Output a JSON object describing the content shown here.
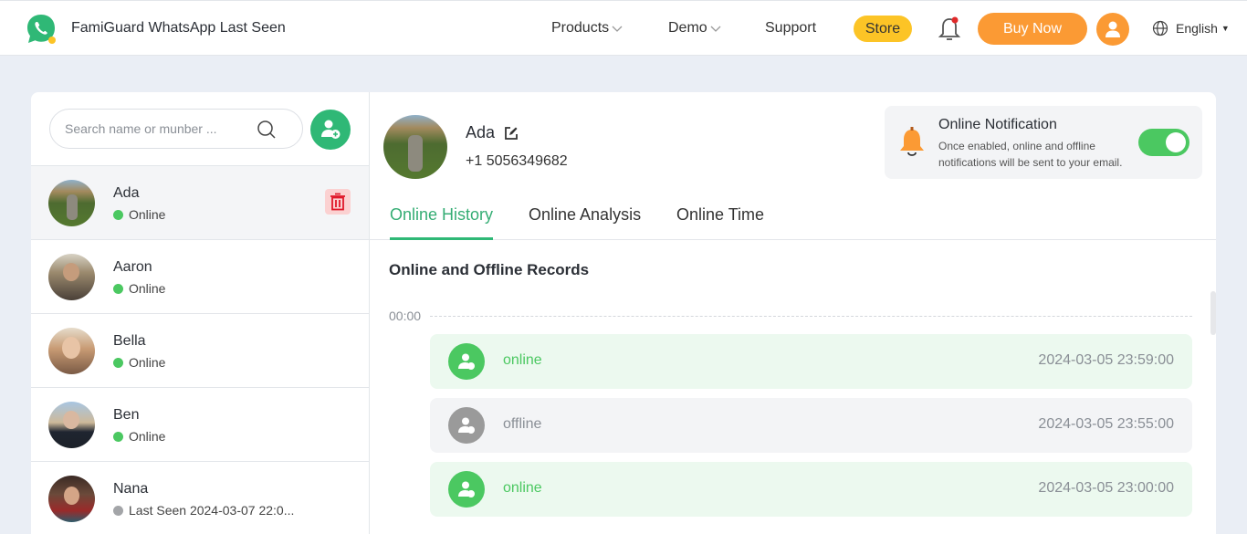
{
  "header": {
    "app_title": "FamiGuard WhatsApp Last Seen",
    "nav": [
      {
        "label": "Products",
        "has_dropdown": true
      },
      {
        "label": "Demo",
        "has_dropdown": true
      },
      {
        "label": "Support",
        "has_dropdown": false
      }
    ],
    "store_label": "Store",
    "buy_label": "Buy Now",
    "language": "English",
    "colors": {
      "brand": "#2fb876",
      "store": "#fcc426",
      "buy": "#fb9a34"
    }
  },
  "sidebar": {
    "search_placeholder": "Search name or munber ...",
    "search_value": "",
    "contacts": [
      {
        "name": "Ada",
        "status": "Online",
        "online": true,
        "selected": true
      },
      {
        "name": "Aaron",
        "status": "Online",
        "online": true
      },
      {
        "name": "Bella",
        "status": "Online",
        "online": true
      },
      {
        "name": "Ben",
        "status": "Online",
        "online": true
      },
      {
        "name": "Nana",
        "status": "Last Seen 2024-03-07 22:0...",
        "online": false
      }
    ]
  },
  "profile": {
    "name": "Ada",
    "phone": "+1 5056349682"
  },
  "notification": {
    "title": "Online Notification",
    "description": "Once enabled, online and offline notifications will be sent to your email.",
    "enabled": true
  },
  "tabs": [
    {
      "label": "Online History",
      "active": true
    },
    {
      "label": "Online Analysis",
      "active": false
    },
    {
      "label": "Online Time",
      "active": false
    }
  ],
  "records": {
    "title": "Online and Offline Records",
    "axis_label": "00:00",
    "items": [
      {
        "state": "online",
        "time": "2024-03-05 23:59:00"
      },
      {
        "state": "offline",
        "time": "2024-03-05 23:55:00"
      },
      {
        "state": "online",
        "time": "2024-03-05 23:00:00"
      }
    ]
  }
}
